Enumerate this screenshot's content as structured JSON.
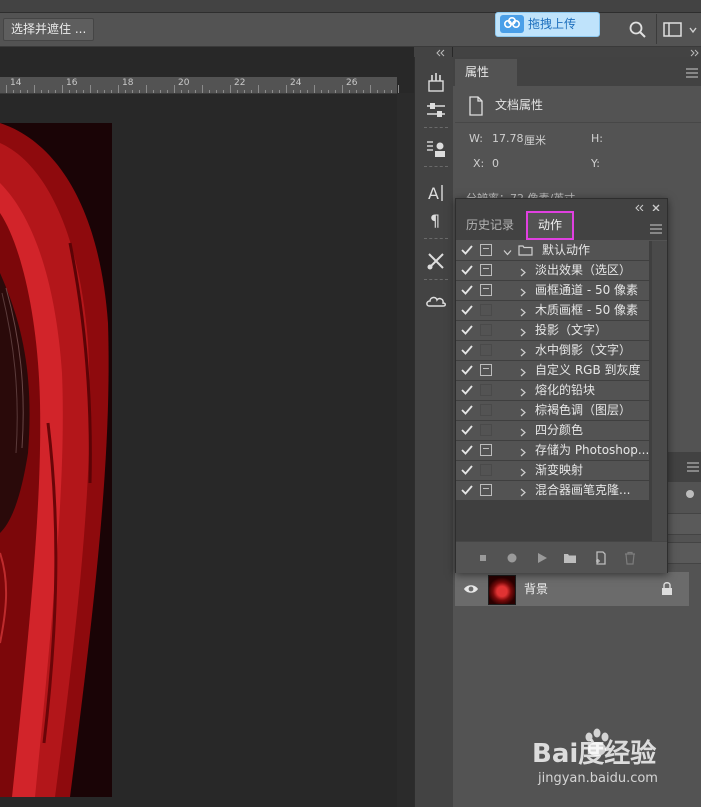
{
  "option_bar": {
    "select_mask_label": "选择并遮住 ...",
    "upload_label": "拖拽上传"
  },
  "ruler": {
    "marks": [
      "14",
      "16",
      "18",
      "20",
      "22",
      "24",
      "26"
    ]
  },
  "properties_panel": {
    "tab_label": "属性",
    "doc_title": "文档属性",
    "w_label": "W:",
    "w_value": "17.78",
    "w_unit": "厘米",
    "h_label": "H:",
    "x_label": "X:",
    "x_value": "0",
    "y_label": "Y:",
    "resolution_text": "分辨率：72 像素/英寸"
  },
  "actions_panel": {
    "history_tab": "历史记录",
    "actions_tab": "动作",
    "items": [
      {
        "label": "默认动作",
        "checked": true,
        "dialog": true,
        "folder": true,
        "expanded": true
      },
      {
        "label": "淡出效果（选区）",
        "checked": true,
        "dialog": true
      },
      {
        "label": "画框通道 - 50 像素",
        "checked": true,
        "dialog": true
      },
      {
        "label": "木质画框 - 50 像素",
        "checked": true,
        "dialog": false
      },
      {
        "label": "投影（文字）",
        "checked": true,
        "dialog": false
      },
      {
        "label": "水中倒影（文字）",
        "checked": true,
        "dialog": false
      },
      {
        "label": "自定义 RGB 到灰度",
        "checked": true,
        "dialog": true
      },
      {
        "label": "熔化的铅块",
        "checked": true,
        "dialog": false
      },
      {
        "label": "棕褐色调（图层）",
        "checked": true,
        "dialog": false
      },
      {
        "label": "四分颜色",
        "checked": true,
        "dialog": false
      },
      {
        "label": "存储为 Photoshop...",
        "checked": true,
        "dialog": true
      },
      {
        "label": "渐变映射",
        "checked": true,
        "dialog": false
      },
      {
        "label": "混合器画笔克隆...",
        "checked": true,
        "dialog": true
      }
    ]
  },
  "layers_panel": {
    "layer_name": "背景"
  },
  "watermark": {
    "brand": "Bai度经验",
    "url": "jingyan.baidu.com"
  },
  "colors": {
    "accent_highlight": "#e040e0",
    "upload_blue": "#1d6fbd",
    "panel_bg": "#535353"
  }
}
